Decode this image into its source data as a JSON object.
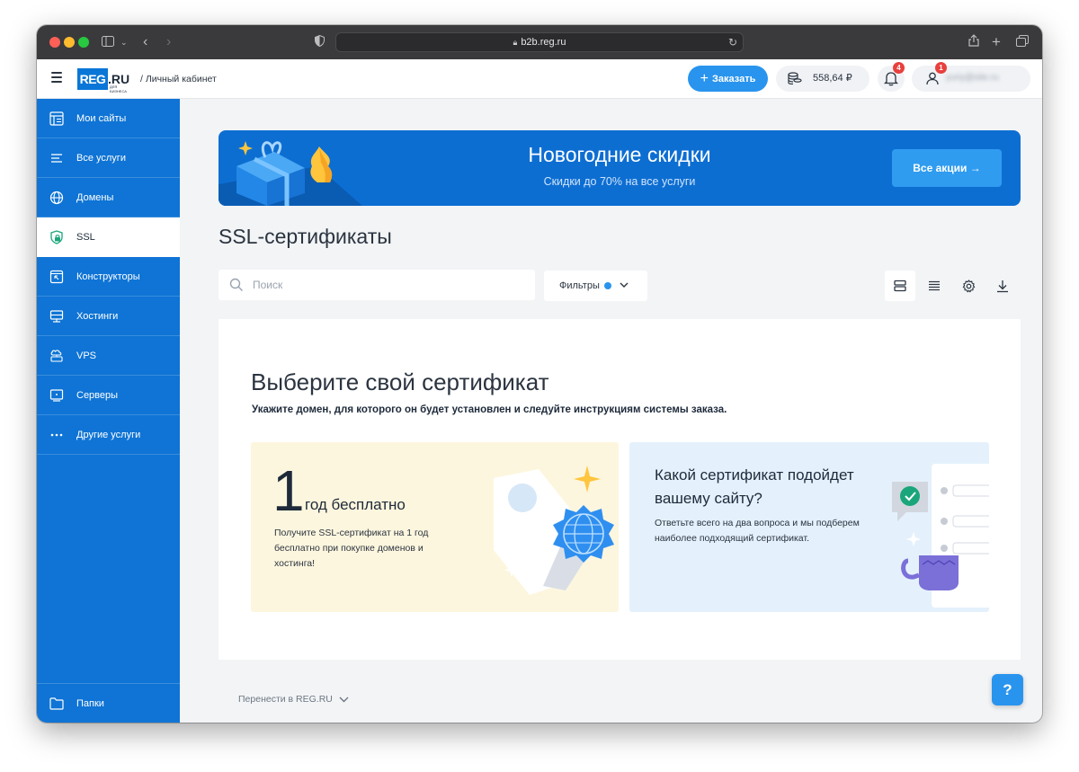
{
  "browser": {
    "url": "b2b.reg.ru"
  },
  "header": {
    "logo_text": "REG",
    "logo_suffix": ".RU",
    "logo_sub": "ДЛЯ БИЗНЕСА",
    "cabinet_label": "/ Личный кабинет",
    "order_label": "Заказать",
    "balance": "558,64 ₽",
    "notifications_count": "4",
    "user_badge_count": "1",
    "user_email": "yuriy@site.ru"
  },
  "sidebar": {
    "items": [
      {
        "label": "Мои сайты",
        "icon": "my-sites-icon"
      },
      {
        "label": "Все услуги",
        "icon": "all-services-icon"
      },
      {
        "label": "Домены",
        "icon": "globe-icon"
      },
      {
        "label": "SSL",
        "icon": "shield-lock-icon",
        "active": true
      },
      {
        "label": "Конструкторы",
        "icon": "constructor-icon"
      },
      {
        "label": "Хостинги",
        "icon": "hosting-icon"
      },
      {
        "label": "VPS",
        "icon": "vps-icon"
      },
      {
        "label": "Серверы",
        "icon": "server-icon"
      },
      {
        "label": "Другие услуги",
        "icon": "dots-icon"
      }
    ],
    "folders_label": "Папки"
  },
  "banner": {
    "title": "Новогодние скидки",
    "subtitle": "Скидки до 70% на все услуги",
    "button_label": "Все акции →"
  },
  "main": {
    "title": "SSL-сертификаты",
    "search_placeholder": "Поиск",
    "filter_label": "Фильтры",
    "card_title": "Выберите свой сертификат",
    "card_subtitle": "Укажите домен, для которого он будет установлен и следуйте инструкциям системы заказа.",
    "promo": {
      "big_number": "1",
      "big_suffix": "год бесплатно",
      "text": "Получите SSL-сертификат на 1 год бесплатно при покупке доменов и хостинга!"
    },
    "quiz": {
      "title": "Какой сертификат подойдет вашему сайту?",
      "text": "Ответьте всего на два вопроса и мы подберем наиболее подходящий сертификат."
    },
    "transfer_label": "Перенести в REG.RU"
  },
  "help_label": "?",
  "colors": {
    "brand_blue": "#0f74d5",
    "accent_blue": "#2994ee",
    "badge_red": "#e8403d",
    "promo_bg": "#fdf6de",
    "quiz_bg": "#e4f1fc"
  }
}
